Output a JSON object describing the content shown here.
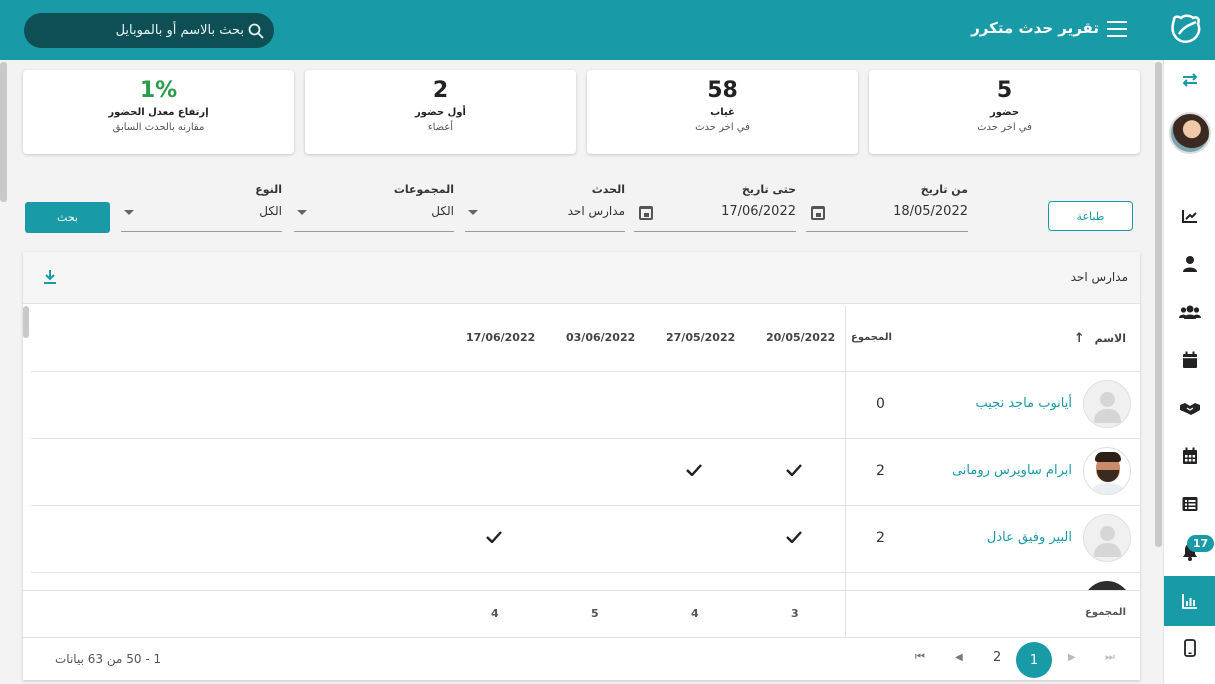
{
  "header": {
    "title": "تقرير حدث متكرر",
    "search_placeholder": "بحث بالاسم أو بالموبايل"
  },
  "sidebar": {
    "items": [
      "swap-icon",
      "avatar",
      "chart-icon",
      "user-icon",
      "users-icon",
      "calendar-icon",
      "handshake-icon",
      "calendar-grid-icon",
      "list-icon",
      "bell-icon",
      "bar-chart-icon",
      "mobile-icon"
    ],
    "notification_count": "17",
    "active_item": "bar-chart-icon"
  },
  "stats": [
    {
      "value": "5",
      "label": "حضور",
      "sub": "في اخر حدث"
    },
    {
      "value": "58",
      "label": "غياب",
      "sub": "في اخر حدث"
    },
    {
      "value": "2",
      "label": "أول حضور",
      "sub": "أعضاء"
    },
    {
      "value": "1%",
      "label": "إرتفاع معدل الحضور",
      "sub": "مقارنه بالحدث السابق",
      "color": "#2a9d4a"
    }
  ],
  "filters": {
    "from_label": "من تاريخ",
    "from_value": "18/05/2022",
    "to_label": "حتى تاريخ",
    "to_value": "17/06/2022",
    "event_label": "الحدث",
    "event_value": "مدارس احد",
    "groups_label": "المجموعات",
    "groups_value": "الكل",
    "type_label": "النوع",
    "type_value": "الكل",
    "print_label": "طباعة",
    "search_label": "بحث"
  },
  "report": {
    "title": "مدارس احد",
    "columns": {
      "name": "الاسم",
      "total": "المجموع",
      "dates": [
        "20/05/2022",
        "27/05/2022",
        "03/06/2022",
        "17/06/2022"
      ]
    },
    "rows": [
      {
        "name": "أيانوب ماجد نجيب",
        "total": "0",
        "checks": [
          false,
          false,
          false,
          false
        ]
      },
      {
        "name": "ابرام ساويرس رومانى",
        "total": "2",
        "checks": [
          true,
          true,
          false,
          false
        ]
      },
      {
        "name": "البير وفيق عادل",
        "total": "2",
        "checks": [
          true,
          false,
          false,
          true
        ]
      }
    ],
    "footer_label": "المجموع",
    "footer_totals": [
      "3",
      "4",
      "5",
      "4"
    ]
  },
  "pagination": {
    "info": "1 - 50 من 63 بيانات",
    "pages": [
      "1",
      "2"
    ],
    "current": "1"
  },
  "colors": {
    "accent": "#199ba7",
    "green": "#2a9d4a"
  }
}
